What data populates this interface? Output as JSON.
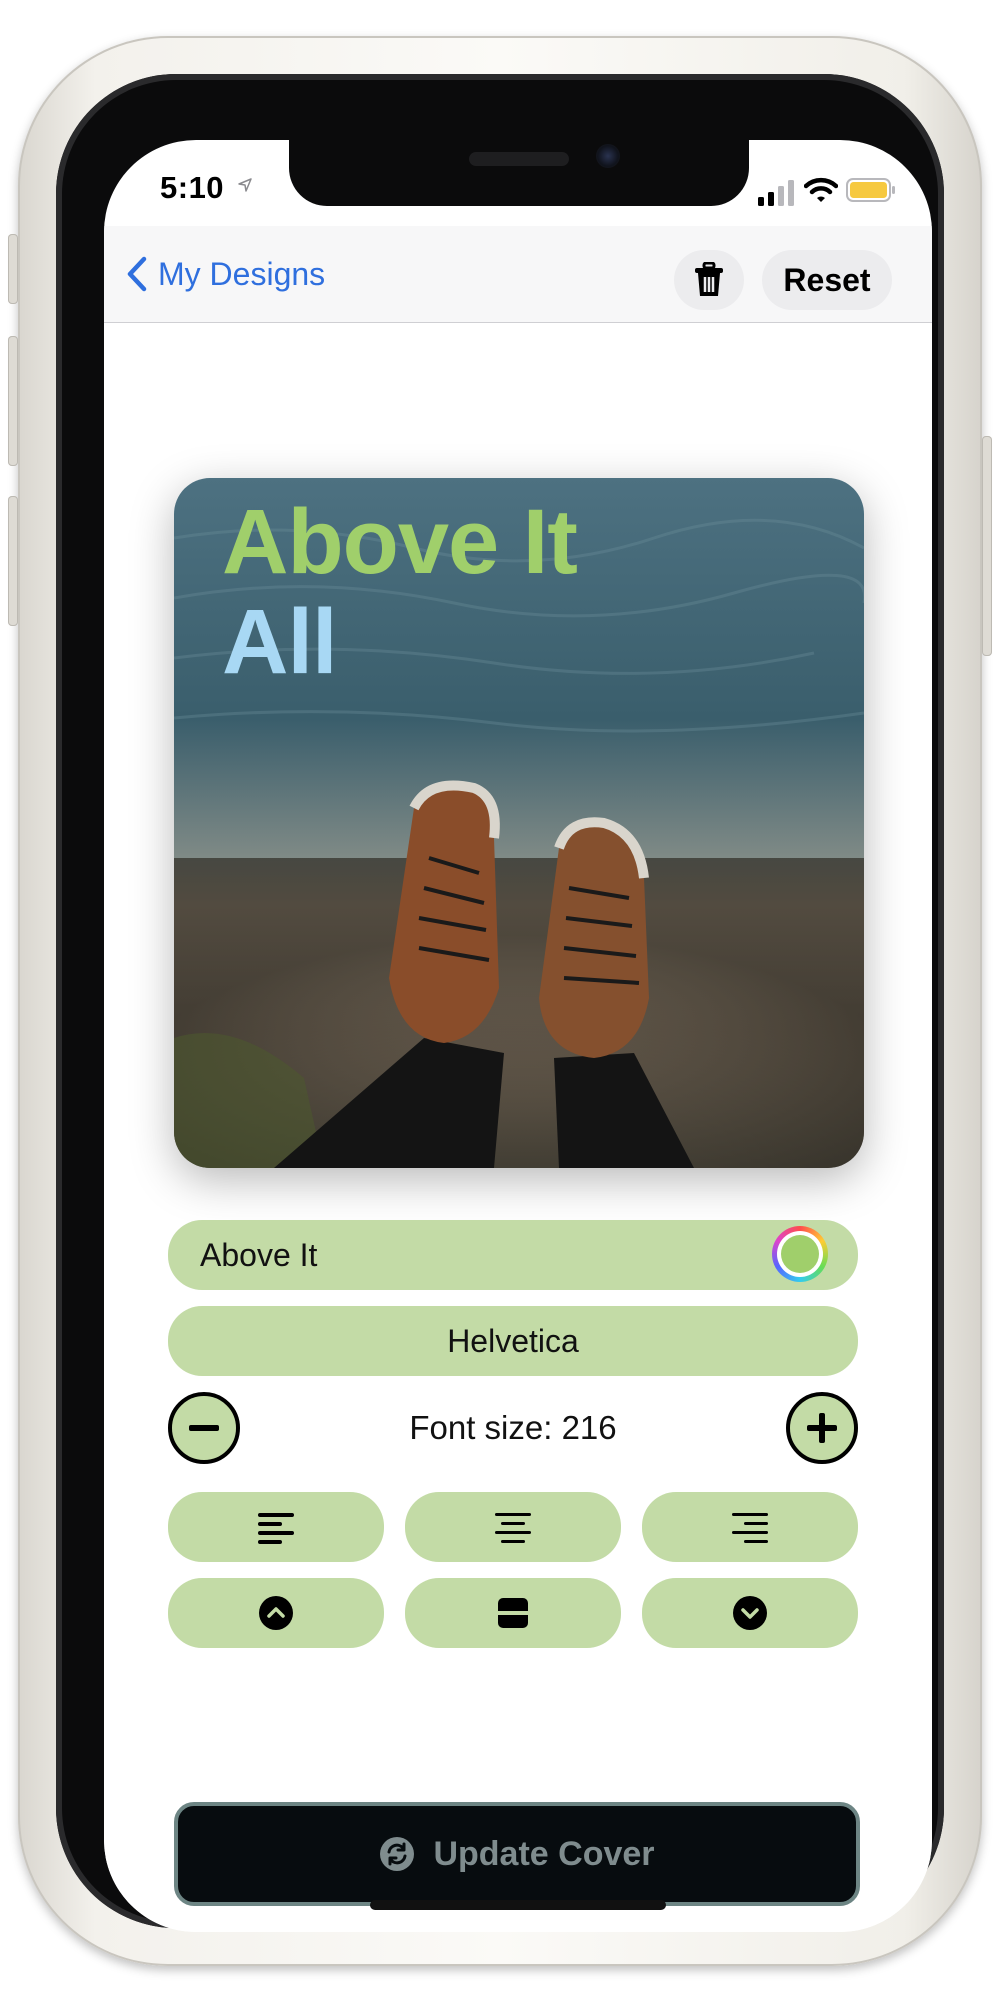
{
  "status_bar": {
    "time": "5:10"
  },
  "nav": {
    "back_label": "My Designs",
    "reset_label": "Reset"
  },
  "cover": {
    "line1": "Above It",
    "line2": "All"
  },
  "editor": {
    "text_value": "Above It",
    "selected_color": "#a0cf6b",
    "font_name": "Helvetica",
    "font_size_label": "Font size: 216",
    "alignment_buttons": [
      "align-left-icon",
      "align-center-icon",
      "align-right-icon"
    ],
    "position_buttons": [
      "chevron-up-circle-icon",
      "align-middle-icon",
      "chevron-down-circle-icon"
    ]
  },
  "update_button": {
    "label": "Update Cover"
  },
  "colors": {
    "accent": "#2f6fde",
    "control_bg": "#c3dba6",
    "title_green": "#a0cf6b",
    "title_blue": "#a8d8f4"
  }
}
